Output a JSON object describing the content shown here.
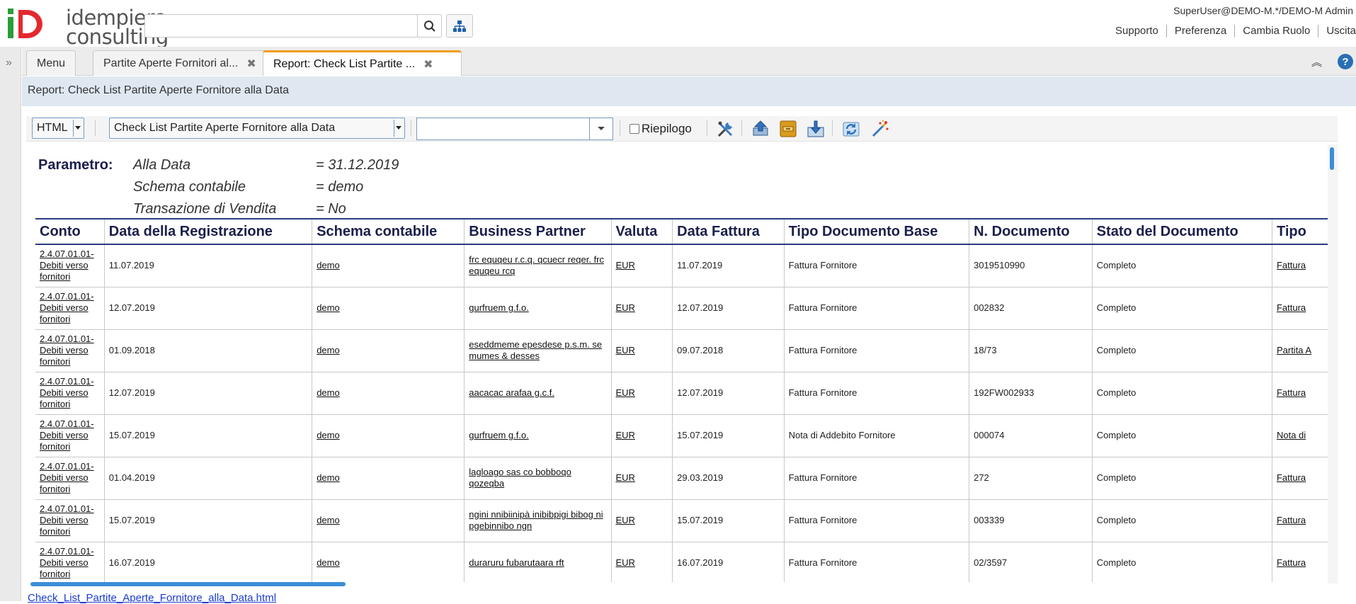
{
  "header": {
    "logo": {
      "line1": "idempiere",
      "line2": "consulting"
    },
    "search_placeholder": "",
    "user": "SuperUser@DEMO-M.*/DEMO-M Admin",
    "links": [
      "Supporto",
      "Preferenza",
      "Cambia Ruolo",
      "Uscita"
    ]
  },
  "tabs": [
    {
      "label": "Menu",
      "closable": false
    },
    {
      "label": "Partite Aperte Fornitori al...",
      "closable": true
    },
    {
      "label": "Report: Check List Partite ...",
      "closable": true,
      "active": true
    }
  ],
  "report_title": "Report: Check List Partite Aperte Fornitore alla Data",
  "toolbar": {
    "format_value": "HTML",
    "report_value": "Check List Partite Aperte Fornitore alla Data",
    "print_format_value": "",
    "summary_label": "Riepilogo",
    "summary_checked": false
  },
  "params": {
    "label": "Parametro:",
    "rows": [
      {
        "name": "Alla Data",
        "value": "= 31.12.2019"
      },
      {
        "name": "Schema contabile",
        "value": "= demo"
      },
      {
        "name": "Transazione di Vendita",
        "value": "= No"
      }
    ]
  },
  "table": {
    "columns": [
      "Conto",
      "Data della Registrazione",
      "Schema contabile",
      "Business Partner",
      "Valuta",
      "Data Fattura",
      "Tipo Documento Base",
      "N. Documento",
      "Stato del Documento",
      "Tipo"
    ],
    "rows": [
      {
        "conto": "2.4.07.01.01-Debiti verso fornitori",
        "data_reg": "11.07.2019",
        "schema": "demo",
        "bp": "frc equqeu r.c.q. qcuecr reqer. frc equqeu rcq",
        "valuta": "EUR",
        "data_fatt": "11.07.2019",
        "tipo_base": "Fattura Fornitore",
        "n_doc": "3019510990",
        "stato": "Completo",
        "tipo": "Fattura"
      },
      {
        "conto": "2.4.07.01.01-Debiti verso fornitori",
        "data_reg": "12.07.2019",
        "schema": "demo",
        "bp": "gurfruem g.f.o.",
        "valuta": "EUR",
        "data_fatt": "12.07.2019",
        "tipo_base": "Fattura Fornitore",
        "n_doc": "002832",
        "stato": "Completo",
        "tipo": "Fattura"
      },
      {
        "conto": "2.4.07.01.01-Debiti verso fornitori",
        "data_reg": "01.09.2018",
        "schema": "demo",
        "bp": "eseddmeme epesdese p.s.m. se mumes & desses",
        "valuta": "EUR",
        "data_fatt": "09.07.2018",
        "tipo_base": "Fattura Fornitore",
        "n_doc": "18/73",
        "stato": "Completo",
        "tipo": "Partita A"
      },
      {
        "conto": "2.4.07.01.01-Debiti verso fornitori",
        "data_reg": "12.07.2019",
        "schema": "demo",
        "bp": "aacacac arafaa g.c.f.",
        "valuta": "EUR",
        "data_fatt": "12.07.2019",
        "tipo_base": "Fattura Fornitore",
        "n_doc": "192FW002933",
        "stato": "Completo",
        "tipo": "Fattura"
      },
      {
        "conto": "2.4.07.01.01-Debiti verso fornitori",
        "data_reg": "15.07.2019",
        "schema": "demo",
        "bp": "gurfruem g.f.o.",
        "valuta": "EUR",
        "data_fatt": "15.07.2019",
        "tipo_base": "Nota di Addebito Fornitore",
        "n_doc": "000074",
        "stato": "Completo",
        "tipo": "Nota di"
      },
      {
        "conto": "2.4.07.01.01-Debiti verso fornitori",
        "data_reg": "01.04.2019",
        "schema": "demo",
        "bp": "lagloago sas co bobboqo qozeqba",
        "valuta": "EUR",
        "data_fatt": "29.03.2019",
        "tipo_base": "Fattura Fornitore",
        "n_doc": "272",
        "stato": "Completo",
        "tipo": "Fattura"
      },
      {
        "conto": "2.4.07.01.01-Debiti verso fornitori",
        "data_reg": "15.07.2019",
        "schema": "demo",
        "bp": "ngini nnibiinipà inibibpigi bibog ni pgebinnibo ngn",
        "valuta": "EUR",
        "data_fatt": "15.07.2019",
        "tipo_base": "Fattura Fornitore",
        "n_doc": "003339",
        "stato": "Completo",
        "tipo": "Fattura"
      },
      {
        "conto": "2.4.07.01.01-Debiti verso fornitori",
        "data_reg": "16.07.2019",
        "schema": "demo",
        "bp": "duraruru fubarutaara rft",
        "valuta": "EUR",
        "data_fatt": "16.07.2019",
        "tipo_base": "Fattura Fornitore",
        "n_doc": "02/3597",
        "stato": "Completo",
        "tipo": "Fattura"
      }
    ]
  },
  "footer_link": "Check_List_Partite_Aperte_Fornitore_alla_Data.html",
  "colors": {
    "accent_tab": "#f09d1a",
    "title_bar": "#dfe8f1",
    "header_text": "#1a1f4a",
    "scroll": "#3b8ed6",
    "logo_red": "#e3282e",
    "logo_green": "#2a9d3a"
  },
  "icons": [
    "search-icon",
    "tree-icon",
    "expand-west-icon",
    "collapse-up-icon",
    "help-icon",
    "customize-icon",
    "send-icon",
    "archive-icon",
    "export-icon",
    "refresh-icon",
    "wizard-icon"
  ]
}
